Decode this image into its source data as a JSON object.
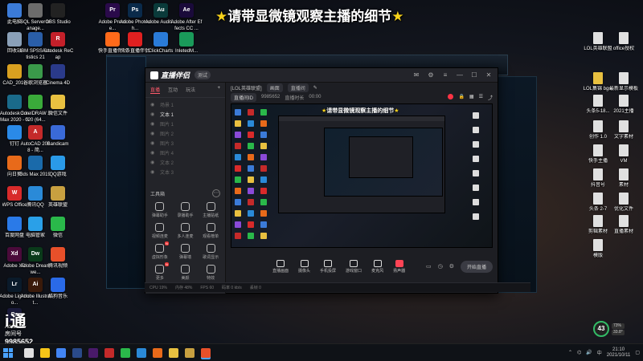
{
  "banner": {
    "star_left": "★",
    "text": "请带显微镜观察主播的细节",
    "star_right": "★"
  },
  "desktop_left": [
    {
      "label": "此电脑",
      "color": "#3b7bd8",
      "icon": "computer-icon"
    },
    {
      "label": "SQL Server Manage...",
      "color": "#6c6c6c",
      "icon": "tools-icon"
    },
    {
      "label": "OBS Studio",
      "color": "#222222",
      "icon": "obs-icon"
    },
    {
      "label": "Adobe Premie...",
      "color": "#2a0a4a",
      "icon": "pr-icon",
      "abbr": "Pr"
    },
    {
      "label": "Adobe Photosh...",
      "color": "#0a2a4a",
      "icon": "ps-icon",
      "abbr": "Ps"
    },
    {
      "label": "Adobe Auditi...",
      "color": "#0a3a3a",
      "icon": "au-icon",
      "abbr": "Au"
    },
    {
      "label": "Adobe After Effects CC ...",
      "color": "#1a0a3a",
      "icon": "ae-icon",
      "abbr": "Ae"
    },
    {
      "label": "回收站",
      "color": "#8aa0b8",
      "icon": "recycle-bin-icon"
    },
    {
      "label": "IBM SPSS Statistics 21",
      "color": "#2a5ea8",
      "icon": "spss-icon"
    },
    {
      "label": "Autodesk ReCap",
      "color": "#c4202a",
      "icon": "recap-icon",
      "abbr": "R"
    },
    {
      "label": "快手直播伴侣",
      "color": "#ff6a1a",
      "icon": "kuaishou-icon"
    },
    {
      "label": "头条直播伴侣",
      "color": "#e02020",
      "icon": "toutiao-icon"
    },
    {
      "label": "ClickCharts",
      "color": "#2a7bd8",
      "icon": "clickcharts-icon"
    },
    {
      "label": "InletedM...",
      "color": "#1a9a5a",
      "icon": "inleted-icon"
    },
    {
      "label": "CAD_2019",
      "color": "#d8a020",
      "icon": "cad-icon"
    },
    {
      "label": "谷歌浏览器",
      "color": "#3a9a4a",
      "icon": "chrome-icon"
    },
    {
      "label": "Cinema 4D",
      "color": "#2a3a8a",
      "icon": "c4d-icon"
    },
    {
      "label": "Autodesk 3ds Max 2020 - Si...",
      "color": "#1a6a8a",
      "icon": "3dsmax-icon"
    },
    {
      "label": "CorelDRAW 2020 (64...",
      "color": "#3aaa3a",
      "icon": "coreldraw-icon"
    },
    {
      "label": "微信文件",
      "color": "#e8c040",
      "icon": "folder-icon"
    },
    {
      "label": "钉钉",
      "color": "#2a8ae8",
      "icon": "dingtalk-icon"
    },
    {
      "label": "AutoCAD 2018 - 简...",
      "color": "#c42a2a",
      "icon": "autocad-icon",
      "abbr": "A"
    },
    {
      "label": "Bandicam",
      "color": "#3a6ad8",
      "icon": "bandicam-icon"
    },
    {
      "label": "向日葵",
      "color": "#e86a1a",
      "icon": "sunlogin-icon"
    },
    {
      "label": "3ds Max 2019",
      "color": "#1a6aaa",
      "icon": "3dsmax2019-icon"
    },
    {
      "label": "QQ游戏",
      "color": "#2a9ae8",
      "icon": "qqgame-icon"
    },
    {
      "label": "WPS Office",
      "color": "#d82a2a",
      "icon": "wps-icon",
      "abbr": "W"
    },
    {
      "label": "腾讯QQ",
      "color": "#2a8ad8",
      "icon": "qq-icon"
    },
    {
      "label": "英雄联盟",
      "color": "#c8a040",
      "icon": "lol-icon"
    },
    {
      "label": "百度网盘",
      "color": "#2a7ae8",
      "icon": "baidupan-icon"
    },
    {
      "label": "电脑管家",
      "color": "#2aa0e8",
      "icon": "pcmanager-icon"
    },
    {
      "label": "微信",
      "color": "#2ab84a",
      "icon": "wechat-icon"
    },
    {
      "label": "Adobe XD",
      "color": "#4a0a3a",
      "icon": "xd-icon",
      "abbr": "Xd"
    },
    {
      "label": "Adobe Dreamwe...",
      "color": "#0a3a1a",
      "icon": "dw-icon",
      "abbr": "Dw"
    },
    {
      "label": "腾讯视频",
      "color": "#e8502a",
      "icon": "tencent-video-icon"
    },
    {
      "label": "Adobe Lightroo...",
      "color": "#0a1a2a",
      "icon": "lr-icon",
      "abbr": "Lr"
    },
    {
      "label": "Adobe Illustrat...",
      "color": "#3a1a0a",
      "icon": "ai-icon",
      "abbr": "Ai"
    },
    {
      "label": "酷狗音乐",
      "color": "#2a6ae8",
      "icon": "kugou-icon"
    },
    {
      "label": "Adobe ...",
      "color": "#1a1a3a",
      "icon": "adobe-icon",
      "abbr": "Ps"
    }
  ],
  "desktop_right": [
    {
      "label": "LOL英雄联盟",
      "color": "#e0e0e0",
      "icon": "doc-icon"
    },
    {
      "label": "office授权",
      "color": "#e0e0e0",
      "icon": "doc-icon"
    },
    {
      "label": "LOL集锦 bgm",
      "color": "#e8c040",
      "icon": "folder-icon"
    },
    {
      "label": "最新显示模板",
      "color": "#e0e0e0",
      "icon": "doc-icon"
    },
    {
      "label": "头条5-18...",
      "color": "#e0e0e0",
      "icon": "doc-icon"
    },
    {
      "label": "2021主播",
      "color": "#e0e0e0",
      "icon": "doc-icon"
    },
    {
      "label": "创作 1.0",
      "color": "#e0e0e0",
      "icon": "doc-icon"
    },
    {
      "label": "文字素材",
      "color": "#e0e0e0",
      "icon": "doc-icon"
    },
    {
      "label": "快手主播",
      "color": "#e0e0e0",
      "icon": "doc-icon"
    },
    {
      "label": "VM",
      "color": "#e0e0e0",
      "icon": "doc-icon"
    },
    {
      "label": "抖音号",
      "color": "#e0e0e0",
      "icon": "doc-icon"
    },
    {
      "label": "素材",
      "color": "#e0e0e0",
      "icon": "doc-icon"
    },
    {
      "label": "头条 2-7",
      "color": "#e0e0e0",
      "icon": "doc-icon"
    },
    {
      "label": "优化文件",
      "color": "#e0e0e0",
      "icon": "doc-icon"
    },
    {
      "label": "剪辑素材",
      "color": "#e0e0e0",
      "icon": "doc-icon"
    },
    {
      "label": "直播素材",
      "color": "#e0e0e0",
      "icon": "doc-icon"
    },
    {
      "label": "模版",
      "color": "#e0e0e0",
      "icon": "doc-icon"
    }
  ],
  "app": {
    "name": "直播伴侣",
    "version_badge": "测试",
    "tabs": [
      "直播",
      "互动",
      "玩法"
    ],
    "add_label": "+",
    "scenes": [
      {
        "label": "场景 1",
        "selected": false
      },
      {
        "label": "文本 1",
        "selected": true
      },
      {
        "label": "图片 1",
        "selected": false
      },
      {
        "label": "图片 2",
        "selected": false
      },
      {
        "label": "图片 3",
        "selected": false
      },
      {
        "label": "图片 4",
        "selected": false
      },
      {
        "label": "文本 2",
        "selected": false
      },
      {
        "label": "文本 3",
        "selected": false
      }
    ],
    "tools_title": "工具箱",
    "tools": [
      {
        "label": "弹幕助手",
        "new": false
      },
      {
        "label": "录播助手",
        "new": false
      },
      {
        "label": "主播贴纸",
        "new": false
      },
      {
        "label": "视频连麦",
        "new": false
      },
      {
        "label": "多人连麦",
        "new": false
      },
      {
        "label": "观看榜单",
        "new": false
      },
      {
        "label": "虚拟形象",
        "new": true
      },
      {
        "label": "弹幕墙",
        "new": false
      },
      {
        "label": "歌词显示",
        "new": false
      },
      {
        "label": "更多",
        "new": true
      },
      {
        "label": "美颜",
        "new": false
      },
      {
        "label": "特效",
        "new": false
      }
    ],
    "footer_left": "头条直播伴侣使用说明",
    "info_row1": [
      "[LOL英雄联盟]",
      "画面",
      "直播间"
    ],
    "info_row2": [
      "直播间ID",
      "9985652",
      "直播时长",
      "00:00"
    ],
    "preview_banner": {
      "star_left": "★",
      "text": "请带显微镜观察主播的细节",
      "star_right": "★"
    },
    "bottom_buttons": [
      {
        "label": "直播画面",
        "red": false
      },
      {
        "label": "摄像头",
        "red": false
      },
      {
        "label": "手机投屏",
        "red": false
      },
      {
        "label": "游戏窗口",
        "red": false
      },
      {
        "label": "麦克风",
        "red": false
      },
      {
        "label": "扬声器",
        "red": true
      }
    ],
    "start_label": "开始直播"
  },
  "status_strip": [
    "CPU 19%",
    "内存 48%",
    "FPS 60",
    "码率 0 kb/s",
    "丢帧 0"
  ],
  "stream_logo": {
    "big": "i通",
    "room": "房间号",
    "num": "9985652"
  },
  "perf": {
    "score": "43",
    "stat1": "73%",
    "stat2": "33.8°"
  },
  "taskbar": {
    "apps": [
      {
        "color": "#e0e0e0",
        "icon": "search-icon"
      },
      {
        "color": "#f5c518",
        "icon": "file-explorer-icon"
      },
      {
        "color": "#4285f4",
        "icon": "chrome-taskbar-icon"
      },
      {
        "color": "#2a4a8a",
        "icon": "ps-taskbar-icon"
      },
      {
        "color": "#4a1a6a",
        "icon": "pr-taskbar-icon"
      },
      {
        "color": "#c42a2a",
        "icon": "app-taskbar-icon"
      },
      {
        "color": "#2ab84a",
        "icon": "wechat-taskbar-icon"
      },
      {
        "color": "#2a8ad8",
        "icon": "qq-taskbar-icon"
      },
      {
        "color": "#e86a1a",
        "icon": "app2-taskbar-icon"
      },
      {
        "color": "#e8c040",
        "icon": "folder-taskbar-icon"
      },
      {
        "color": "#c8a040",
        "icon": "lol-taskbar-icon"
      },
      {
        "color": "#e8502a",
        "icon": "stream-taskbar-icon"
      }
    ],
    "time": "21:10",
    "date": "2021/10/11"
  }
}
